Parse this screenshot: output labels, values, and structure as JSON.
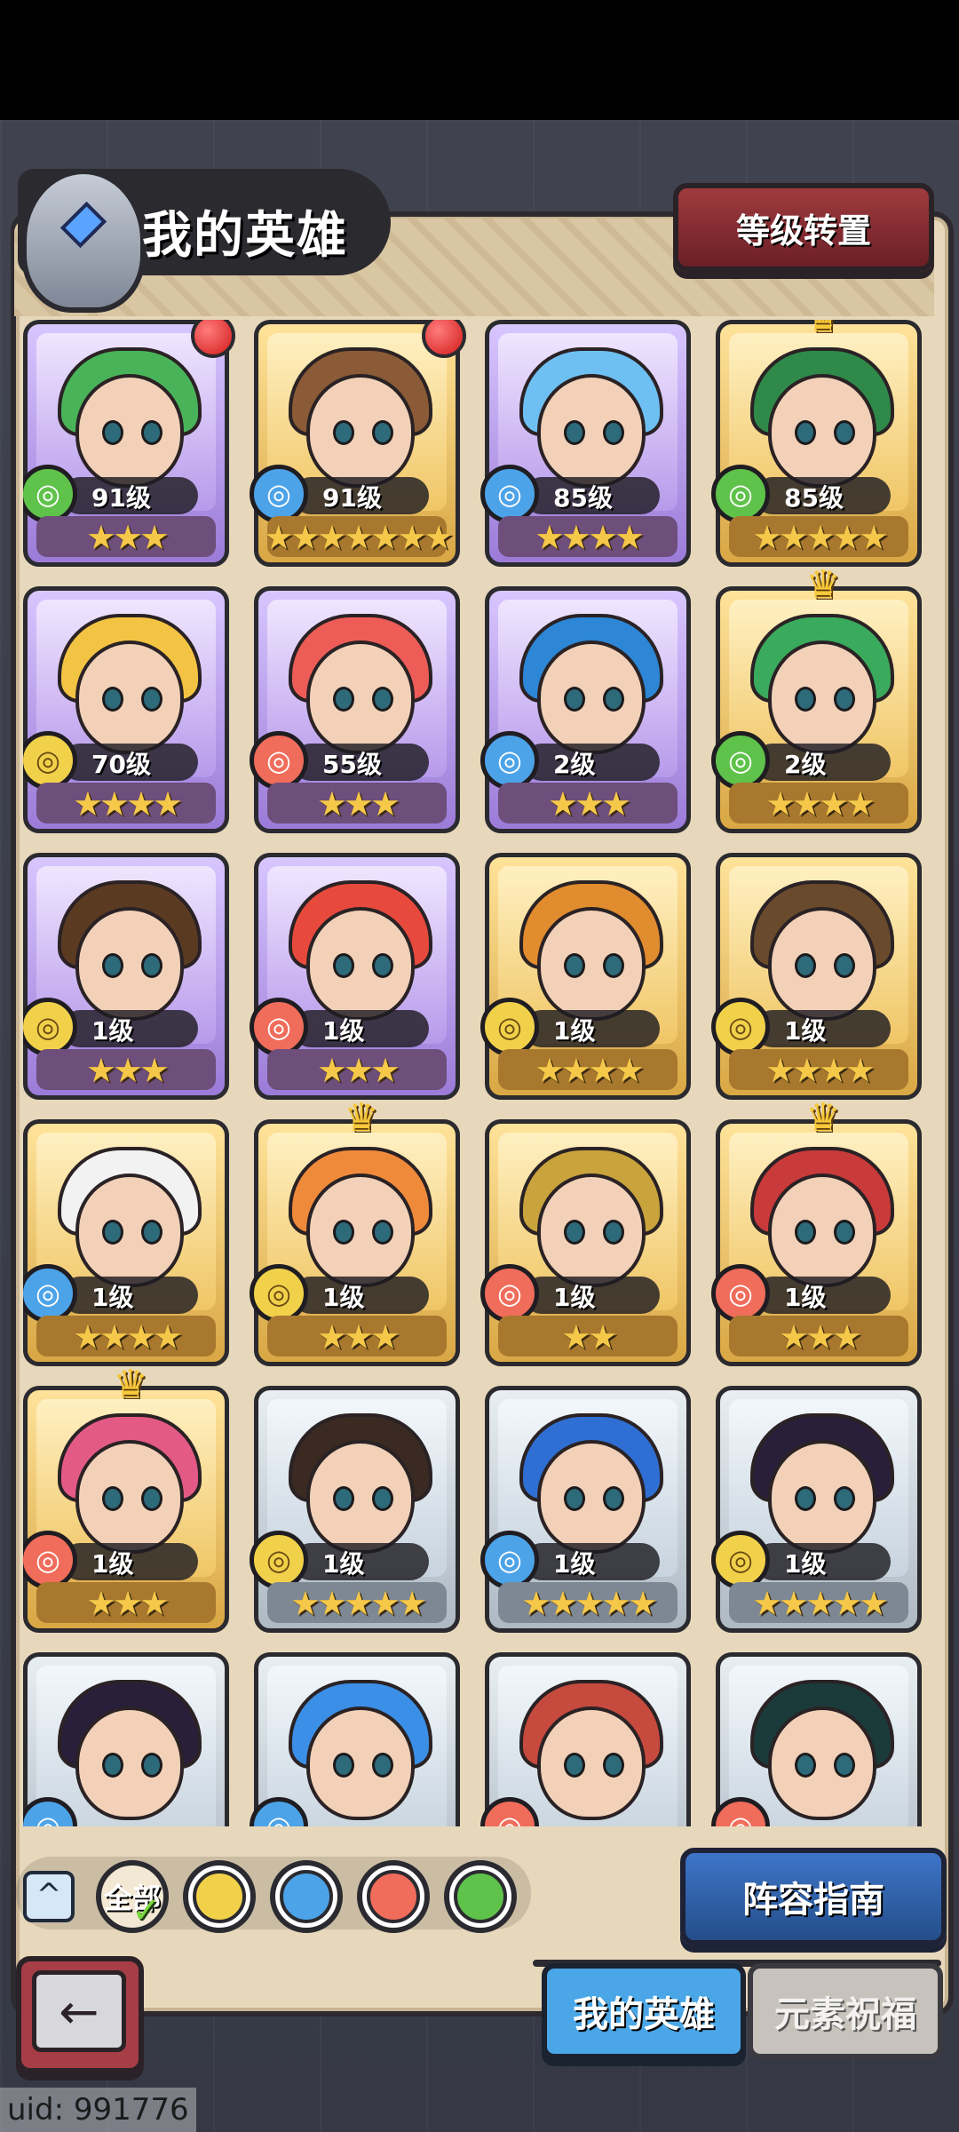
{
  "header": {
    "title": "我的英雄",
    "level_transfer_button": "等级转置"
  },
  "heroes": [
    {
      "level": "91级",
      "element": "wind",
      "stars": "★★★",
      "rarity": "purple",
      "badge": "red-dot",
      "hair": "#49b35a"
    },
    {
      "level": "91级",
      "element": "water",
      "stars": "★★★★★★★",
      "rarity": "gold",
      "badge": "red-dot",
      "hair": "#8a5b36"
    },
    {
      "level": "85级",
      "element": "water",
      "stars": "★★★★",
      "rarity": "purple",
      "badge": "",
      "hair": "#6fc0f2"
    },
    {
      "level": "85级",
      "element": "wind",
      "stars": "★★★★★",
      "rarity": "gold",
      "badge": "crown",
      "hair": "#2f8a4a"
    },
    {
      "level": "70级",
      "element": "earth",
      "stars": "★★★★",
      "rarity": "purple",
      "badge": "",
      "hair": "#f3c443"
    },
    {
      "level": "55级",
      "element": "fire",
      "stars": "★★★",
      "rarity": "purple",
      "badge": "",
      "hair": "#ee5c57"
    },
    {
      "level": "2级",
      "element": "water",
      "stars": "★★★",
      "rarity": "purple",
      "badge": "",
      "hair": "#2d86d6"
    },
    {
      "level": "2级",
      "element": "wind",
      "stars": "★★★★",
      "rarity": "gold",
      "badge": "crown",
      "hair": "#3aaa5c"
    },
    {
      "level": "1级",
      "element": "earth",
      "stars": "★★★",
      "rarity": "purple",
      "badge": "",
      "hair": "#5b3a22"
    },
    {
      "level": "1级",
      "element": "fire",
      "stars": "★★★",
      "rarity": "purple",
      "badge": "",
      "hair": "#e74a3d"
    },
    {
      "level": "1级",
      "element": "earth",
      "stars": "★★★★",
      "rarity": "gold",
      "badge": "",
      "hair": "#e18c2f"
    },
    {
      "level": "1级",
      "element": "earth",
      "stars": "★★★★",
      "rarity": "gold",
      "badge": "",
      "hair": "#6a4a2c"
    },
    {
      "level": "1级",
      "element": "water",
      "stars": "★★★★",
      "rarity": "gold",
      "badge": "",
      "hair": "#f2f2f2"
    },
    {
      "level": "1级",
      "element": "earth",
      "stars": "★★★",
      "rarity": "gold",
      "badge": "crown",
      "hair": "#f08a3b"
    },
    {
      "level": "1级",
      "element": "fire",
      "stars": "★★",
      "rarity": "gold",
      "badge": "",
      "hair": "#c9a33c"
    },
    {
      "level": "1级",
      "element": "fire",
      "stars": "★★★",
      "rarity": "gold",
      "badge": "crown",
      "hair": "#c93a3a"
    },
    {
      "level": "1级",
      "element": "fire",
      "stars": "★★★",
      "rarity": "gold",
      "badge": "crown",
      "hair": "#e45a87"
    },
    {
      "level": "1级",
      "element": "earth",
      "stars": "★★★★★",
      "rarity": "silver",
      "badge": "",
      "hair": "#3a2a22"
    },
    {
      "level": "1级",
      "element": "water",
      "stars": "★★★★★",
      "rarity": "silver",
      "badge": "",
      "hair": "#2f6fd4"
    },
    {
      "level": "1级",
      "element": "earth",
      "stars": "★★★★★",
      "rarity": "silver",
      "badge": "",
      "hair": "#2a1f3a"
    },
    {
      "level": "",
      "element": "water",
      "stars": "",
      "rarity": "silver",
      "badge": "",
      "hair": "#2a1f3a"
    },
    {
      "level": "",
      "element": "water",
      "stars": "",
      "rarity": "silver",
      "badge": "",
      "hair": "#3b8fe6"
    },
    {
      "level": "",
      "element": "fire",
      "stars": "",
      "rarity": "silver",
      "badge": "",
      "hair": "#c64a3e"
    },
    {
      "level": "",
      "element": "fire",
      "stars": "",
      "rarity": "silver",
      "badge": "",
      "hair": "#1b3a3a"
    }
  ],
  "filters": {
    "collapse_icon": "caret-up-icon",
    "all_label": "全部",
    "elements": [
      "earth-icon",
      "water-icon",
      "fire-icon",
      "wind-icon"
    ]
  },
  "footer": {
    "guide_button": "阵容指南",
    "back_icon": "back-arrow-icon",
    "tabs": [
      {
        "label": "我的英雄",
        "active": true
      },
      {
        "label": "元素祝福",
        "active": false
      }
    ]
  },
  "uid_text": "uid: 991776",
  "colors": {
    "accent_red": "#a73d46",
    "accent_blue": "#3e75c8",
    "panel_bg": "#e7d8bb"
  }
}
